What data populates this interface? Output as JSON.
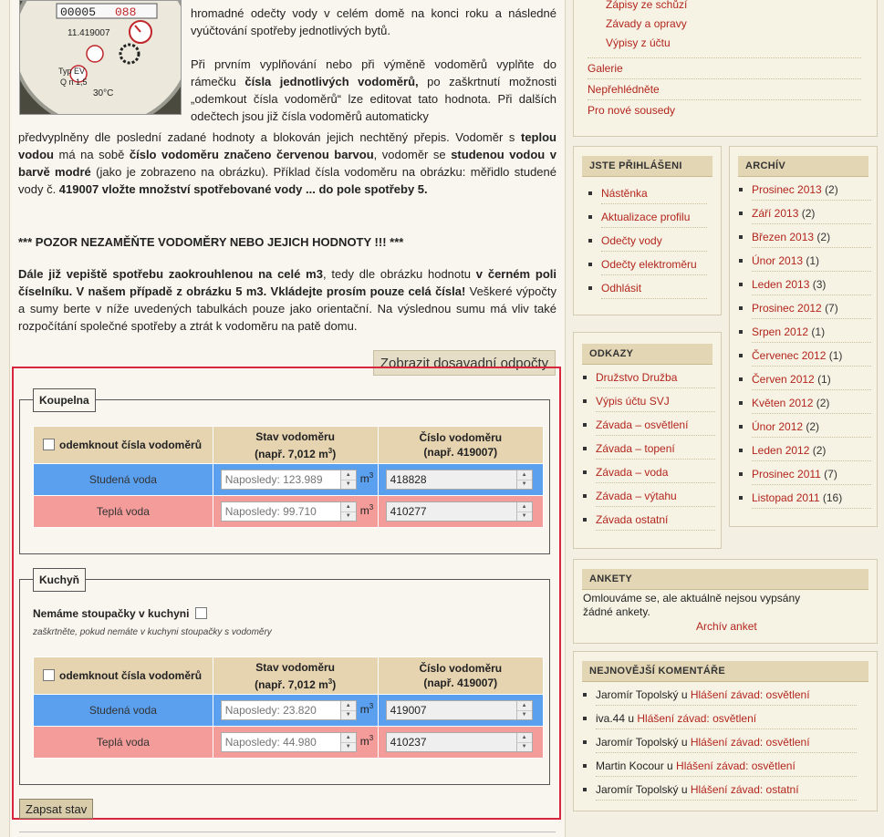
{
  "intro": {
    "p1": "hromadné odečty vody v celém domě na konci roku a následné vyúčtování spotřeby jednotlivých bytů.",
    "p2a": "Při prvním vyplňování nebo při výměně vodoměrů vyplňte do rámečku ",
    "p2b": "čísla jednotlivých vodoměrů,",
    "p2c": " po zaškrtnutí možnosti „odemkout čísla vodoměrů“ lze editovat tato hodnota. Při dalších odečtech jsou již čísla vodoměrů automaticky",
    "p2d": "předvyplněny dle poslední zadané hodnoty a blokován jejich nechtěný přepis. Vodoměr s ",
    "p2e": "teplou vodou",
    "p2f": " má na sobě ",
    "p2g": "číslo vodoměru značeno červenou barvou",
    "p2h": ", vodoměr se ",
    "p2i": "studenou vodou  v barvě modré",
    "p2j": " (jako je zobrazeno na obrázku). Příklad čísla vodoměru na obrázku:  měřidlo studené vody č. ",
    "p2k": "419007  vložte množství spotřebované vody ... do pole spotřeby 5.",
    "p3": "*** POZOR NEZAMĚŇTE VODOMĚRY NEBO JEJICH HODNOTY !!! ***",
    "p4a": "Dále již vepiště spotřebu zaokrouhlenou na celé m3",
    "p4b": ", tedy dle obrázku hodnotu ",
    "p4c": "v černém poli číselníku. V našem případě z obrázku 5 m3.  Vkládejte prosím pouze celá čísla!",
    "p4d": " Veškeré výpočty a sumy berte v níže uvedených tabulkách pouze jako orientační. Na výslednou sumu má vliv také rozpočítání společné spotřeby a ztrát k vodoměru na patě domu."
  },
  "meter_photo": {
    "digits": "00005",
    "red_digits": "088",
    "serial": "11.419007",
    "type": "Typ EV",
    "spec": "Q n 1,5",
    "temp": "30°C"
  },
  "show_prev_label": "Zobrazit dosavadní odpočty",
  "table_headers": {
    "unlock": "odemknout čísla vodoměrů",
    "stav_line1": "Stav vodoměru",
    "stav_line2": "(např. 7,012 m",
    "stav_sup": "3",
    "stav_end": ")",
    "cislo_line1": "Číslo vodoměru",
    "cislo_line2": "(např. 419007)"
  },
  "unit_base": "m",
  "unit_sup": "3",
  "koupelna": {
    "title": "Koupelna",
    "cold_label": "Studená voda",
    "cold_placeholder": "Naposledy: 123.989",
    "cold_number": "418828",
    "hot_label": "Teplá voda",
    "hot_placeholder": "Naposledy: 99.710",
    "hot_number": "410277"
  },
  "kuchyn": {
    "title": "Kuchyň",
    "no_pipes_label": "Nemáme stoupačky v kuchyni",
    "no_pipes_hint": "zaškrtněte, pokud nemáte v kuchyni stoupačky s vodoměry",
    "cold_label": "Studená voda",
    "cold_placeholder": "Naposledy: 23.820",
    "cold_number": "419007",
    "hot_label": "Teplá voda",
    "hot_placeholder": "Naposledy: 44.980",
    "hot_number": "410237"
  },
  "save_label": "Zapsat stav",
  "sidebar": {
    "top_links": [
      "Zápisy ze schůzí",
      "Závady a opravy",
      "Výpisy z účtu"
    ],
    "main_links": [
      "Galerie",
      "Nepřehlédněte",
      "Pro nové sousedy"
    ],
    "logged": {
      "title": "JSTE PŘIHLÁŠENI",
      "items": [
        "Nástěnka",
        "Aktualizace profilu",
        "Odečty vody",
        "Odečty elektroměru",
        "Odhlásit"
      ]
    },
    "links": {
      "title": "ODKAZY",
      "items": [
        "Družstvo Družba",
        "Výpis účtu SVJ",
        "Závada – osvětlení",
        "Závada – topení",
        "Závada – voda",
        "Závada – výtahu",
        "Závada ostatní"
      ]
    },
    "archive": {
      "title": "ARCHÍV",
      "items": [
        {
          "label": "Prosinec 2013",
          "count": "(2)"
        },
        {
          "label": "Září 2013",
          "count": "(2)"
        },
        {
          "label": "Březen 2013",
          "count": "(2)"
        },
        {
          "label": "Únor 2013",
          "count": "(1)"
        },
        {
          "label": "Leden 2013",
          "count": "(3)"
        },
        {
          "label": "Prosinec 2012",
          "count": "(7)"
        },
        {
          "label": "Srpen 2012",
          "count": "(1)"
        },
        {
          "label": "Červenec 2012",
          "count": "(1)"
        },
        {
          "label": "Červen 2012",
          "count": "(1)"
        },
        {
          "label": "Květen 2012",
          "count": "(2)"
        },
        {
          "label": "Únor 2012",
          "count": "(2)"
        },
        {
          "label": "Leden 2012",
          "count": "(2)"
        },
        {
          "label": "Prosinec 2011",
          "count": "(7)"
        },
        {
          "label": "Listopad 2011",
          "count": "(16)"
        }
      ]
    },
    "polls": {
      "title": "ANKETY",
      "text": "Omlouváme se, ale aktuálně nejsou vypsány žádné ankety.",
      "archive_link": "Archív anket"
    },
    "comments": {
      "title": "NEJNOVĚJŠÍ KOMENTÁŘE",
      "connector": " u ",
      "items": [
        {
          "author": "Jaromír Topolský",
          "post": "Hlášení závad: osvětlení"
        },
        {
          "author": "iva.44",
          "post": "Hlášení závad: osvětlení"
        },
        {
          "author": "Jaromír Topolský",
          "post": "Hlášení závad: osvětlení"
        },
        {
          "author": "Martin Kocour",
          "post": "Hlášení závad: osvětlení"
        },
        {
          "author": "Jaromír Topolský",
          "post": "Hlášení závad: ostatní"
        }
      ]
    }
  }
}
